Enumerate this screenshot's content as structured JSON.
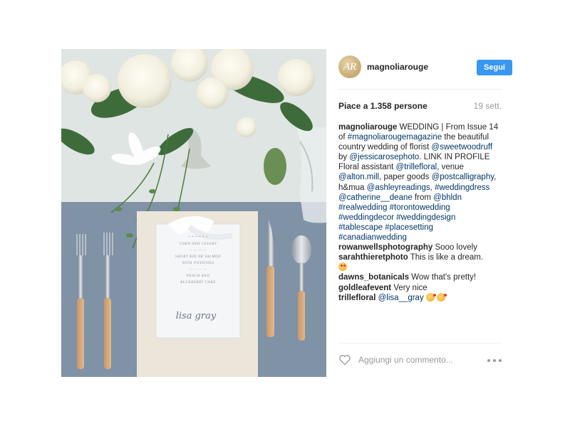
{
  "account": {
    "avatar_initials": "AR",
    "username": "magnoliarouge",
    "follow_label": "Segui"
  },
  "stats": {
    "likes": "Piace a 1.358 persone",
    "date": "19 sett."
  },
  "caption": {
    "username": "magnoliarouge",
    "segments": [
      {
        "t": " WEDDING | From Issue 14 of ",
        "tag": false
      },
      {
        "t": "#magnoliarougemagazine",
        "tag": true
      },
      {
        "t": " the beautiful country wedding of florist ",
        "tag": false
      },
      {
        "t": "@sweetwoodruff",
        "tag": true
      },
      {
        "t": " by ",
        "tag": false
      },
      {
        "t": "@jessicarosephoto",
        "tag": true
      },
      {
        "t": ". LINK IN PROFILE",
        "tag": false
      },
      {
        "t": "\nFloral assistant ",
        "tag": false
      },
      {
        "t": "@trillefloral",
        "tag": true
      },
      {
        "t": ", venue ",
        "tag": false
      },
      {
        "t": "@alton.mill",
        "tag": true
      },
      {
        "t": ", paper goods ",
        "tag": false
      },
      {
        "t": "@postcalligraphy",
        "tag": true
      },
      {
        "t": ", h&mua ",
        "tag": false
      },
      {
        "t": "@ashleyreadings",
        "tag": true
      },
      {
        "t": ", ",
        "tag": false
      },
      {
        "t": "#weddingdress",
        "tag": true
      },
      {
        "t": " ",
        "tag": false
      },
      {
        "t": "@catherine__deane",
        "tag": true
      },
      {
        "t": " from ",
        "tag": false
      },
      {
        "t": "@bhldn",
        "tag": true
      },
      {
        "t": " ",
        "tag": false
      },
      {
        "t": "#realwedding",
        "tag": true
      },
      {
        "t": " ",
        "tag": false
      },
      {
        "t": "#torontowedding",
        "tag": true
      },
      {
        "t": " ",
        "tag": false
      },
      {
        "t": "#weddingdecor",
        "tag": true
      },
      {
        "t": " ",
        "tag": false
      },
      {
        "t": "#weddingdesign",
        "tag": true
      },
      {
        "t": " ",
        "tag": false
      },
      {
        "t": "#tablescape",
        "tag": true
      },
      {
        "t": " ",
        "tag": false
      },
      {
        "t": "#placesetting",
        "tag": true
      },
      {
        "t": " ",
        "tag": false
      },
      {
        "t": "#canadianwedding",
        "tag": true
      }
    ]
  },
  "comments": [
    {
      "user": "rowanwellsphotography",
      "text": "Sooo lovely",
      "mention": "",
      "emojis": []
    },
    {
      "user": "sarahthieretphoto",
      "text": "This is like a dream.",
      "mention": "",
      "emojis": [
        "heart-eyes"
      ],
      "emoji_newline": true
    },
    {
      "user": "dawns_botanicals",
      "text": "Wow that's pretty!",
      "mention": "",
      "emojis": []
    },
    {
      "user": "goldleafevent",
      "text": "Very nice",
      "mention": "",
      "emojis": []
    },
    {
      "user": "trillefloral",
      "text": "",
      "mention": "@lisa__gray",
      "emojis": [
        "kiss",
        "kiss"
      ]
    }
  ],
  "comment_box": {
    "placeholder": "Aggiungi un commento..."
  },
  "photo": {
    "menu_lines": [
      "* * * * * *",
      "CORN AND CELERY",
      "-- -- -- --",
      "SHORT RIB OR SALMON",
      "WITH POTATOES",
      "-- -- -- --",
      "PEACH AND",
      "BLUEBERRY CAKE"
    ],
    "place_card_name": "lisa gray"
  },
  "colors": {
    "accent": "#3897f0",
    "link": "#003569",
    "muted": "#999999"
  }
}
